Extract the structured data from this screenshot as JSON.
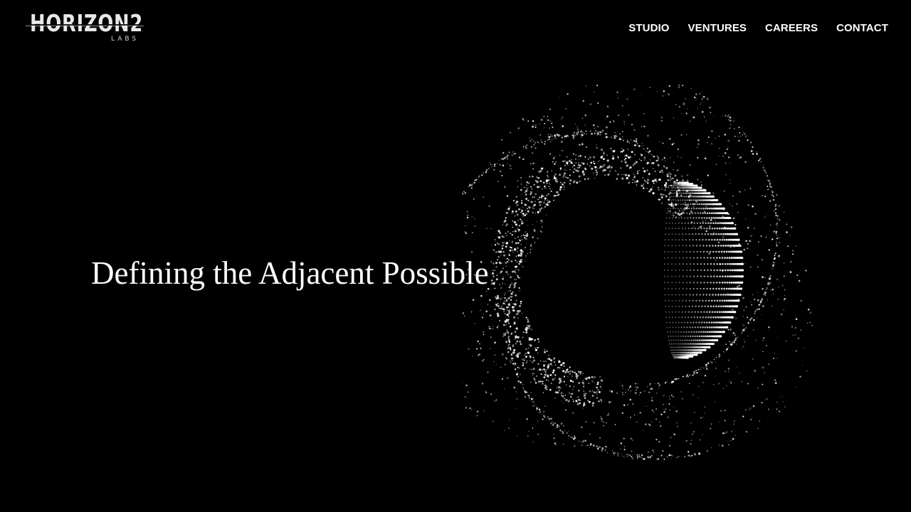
{
  "brand": {
    "name": "HORIZON2",
    "sub": "LABS"
  },
  "nav": {
    "items": [
      {
        "label": "STUDIO"
      },
      {
        "label": "VENTURES"
      },
      {
        "label": "CAREERS"
      },
      {
        "label": "CONTACT"
      }
    ]
  },
  "hero": {
    "title": "Defining the Adjacent Possible",
    "visual_icon": "particle-sphere-graphic"
  },
  "colors": {
    "background": "#000000",
    "text": "#ffffff"
  }
}
